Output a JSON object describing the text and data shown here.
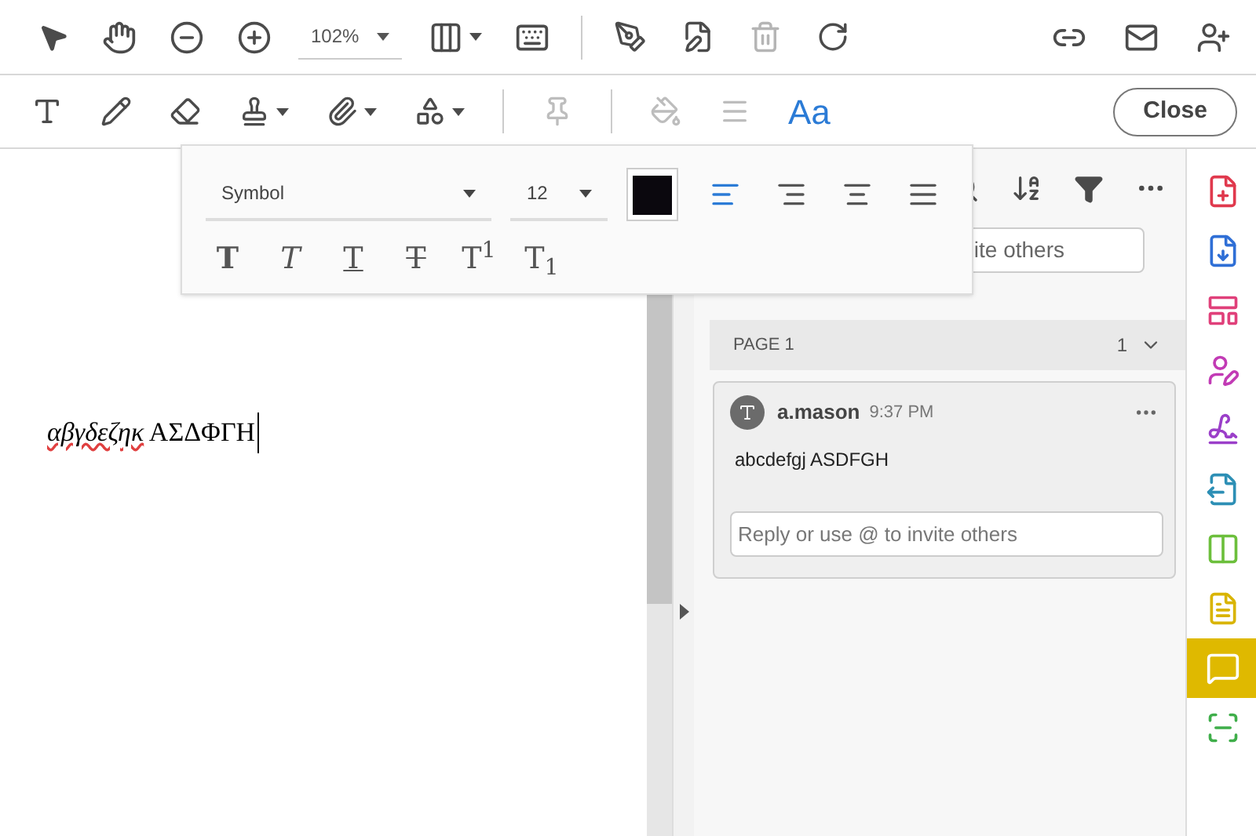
{
  "toolbar": {
    "zoom": "102%"
  },
  "tools": [
    {
      "kind": "textbox",
      "selected": false
    },
    {
      "kind": "pencil",
      "selected": false
    },
    {
      "kind": "eraser",
      "selected": false
    },
    {
      "kind": "stamp",
      "selected": false
    },
    {
      "kind": "attach",
      "selected": false
    },
    {
      "kind": "shapes",
      "selected": false
    },
    {
      "kind": "pin",
      "selected": false
    },
    {
      "kind": "fill",
      "selected": false
    },
    {
      "kind": "lines",
      "selected": false
    }
  ],
  "text_tool": {
    "label": "Aa",
    "selected": true
  },
  "close_button": "Close",
  "format_popup": {
    "font": "Symbol",
    "size": "12",
    "alignments": [
      {
        "kind": "left",
        "selected": true
      },
      {
        "kind": "right",
        "selected": false
      },
      {
        "kind": "center",
        "selected": false
      },
      {
        "kind": "justify",
        "selected": false
      }
    ],
    "styles": [
      {
        "kind": "bold",
        "label": "T"
      },
      {
        "kind": "italic",
        "label": "T"
      },
      {
        "kind": "underline",
        "label": "T"
      },
      {
        "kind": "strike",
        "label": "T"
      },
      {
        "kind": "super",
        "label": "T$^{1}$"
      },
      {
        "kind": "sub",
        "label": "T$_{1}$"
      }
    ]
  },
  "document": {
    "text": "*αβγδεζηκ* ΑΣΔΦΓΗ"
  },
  "comments": {
    "search_field_text": "ite others",
    "page_label": "PAGE 1",
    "page_count": "1",
    "items": [
      {
        "author": "a.mason",
        "time": "9:37 PM",
        "text": "abcdefgj ASDFGH",
        "reply_placeholder": "Reply or use @ to invite others"
      }
    ]
  },
  "rail": [
    {
      "kind": "create",
      "color": "#e0394d",
      "selected": false
    },
    {
      "kind": "combine",
      "color": "#2f6fd6",
      "selected": false
    },
    {
      "kind": "organize",
      "color": "#e0407a",
      "selected": false
    },
    {
      "kind": "request",
      "color": "#c23bb5",
      "selected": false
    },
    {
      "kind": "sign",
      "color": "#9b3fc9",
      "selected": false
    },
    {
      "kind": "export",
      "color": "#2d8fb5",
      "selected": false
    },
    {
      "kind": "compare",
      "color": "#6cbf3c",
      "selected": false
    },
    {
      "kind": "note",
      "color": "#d9b400",
      "selected": false
    },
    {
      "kind": "comment",
      "color": "#dfb900",
      "selected": true
    },
    {
      "kind": "scan",
      "color": "#3fae4a",
      "selected": false
    }
  ]
}
